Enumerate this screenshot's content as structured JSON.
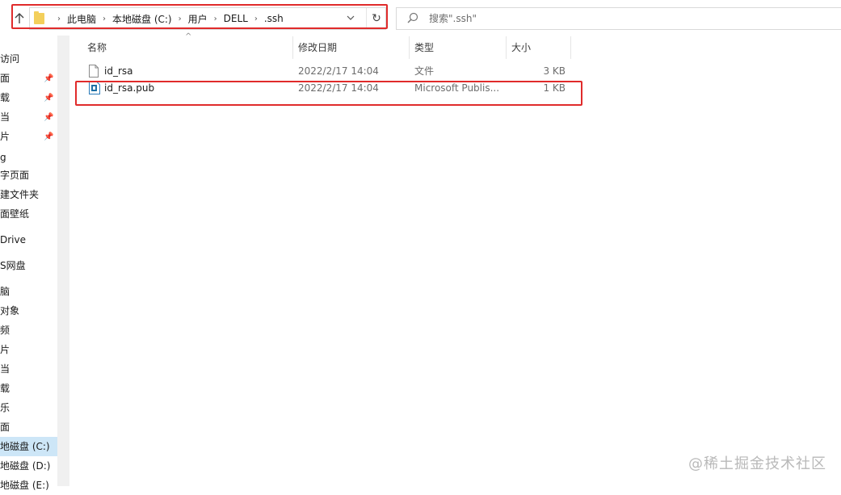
{
  "address_bar": {
    "crumbs": [
      "此电脑",
      "本地磁盘 (C:)",
      "用户",
      "DELL",
      ".ssh"
    ]
  },
  "search": {
    "placeholder": "搜索\".ssh\""
  },
  "nav": {
    "items": [
      {
        "label": "访问"
      },
      {
        "label": "面"
      },
      {
        "label": "载"
      },
      {
        "label": "当"
      },
      {
        "label": "片"
      },
      {
        "label": "g"
      },
      {
        "label": "字页面"
      },
      {
        "label": "建文件夹"
      },
      {
        "label": "面壁纸"
      },
      {
        "label": "Drive"
      },
      {
        "label": "S网盘"
      },
      {
        "label": "脑"
      },
      {
        "label": " 对象"
      },
      {
        "label": "频"
      },
      {
        "label": "片"
      },
      {
        "label": "当"
      },
      {
        "label": "载"
      },
      {
        "label": "乐"
      },
      {
        "label": "面"
      },
      {
        "label": "地磁盘 (C:)"
      },
      {
        "label": "地磁盘 (D:)"
      },
      {
        "label": "地磁盘 (E:)"
      }
    ]
  },
  "columns": {
    "name": "名称",
    "date": "修改日期",
    "type": "类型",
    "size": "大小"
  },
  "files": [
    {
      "name": "id_rsa",
      "date": "2022/2/17 14:04",
      "type": "文件",
      "size": "3 KB"
    },
    {
      "name": "id_rsa.pub",
      "date": "2022/2/17 14:04",
      "type": "Microsoft Publis...",
      "size": "1 KB"
    }
  ],
  "watermark": "@稀土掘金技术社区"
}
